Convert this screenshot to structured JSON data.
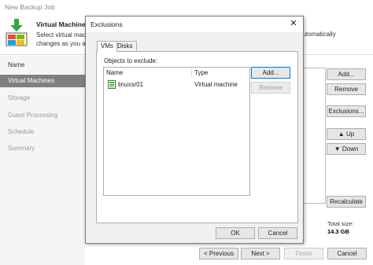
{
  "window": {
    "title": "New Backup Job"
  },
  "header": {
    "title": "Virtual Machines",
    "desc": "Select virtual machines to process via container, or granular changes as you add new VMs to container.",
    "desc_line1": "Select virtual mach",
    "desc_line2": "changes as you ad",
    "desc_right": "automatically"
  },
  "sidebar": {
    "items": [
      {
        "label": "Name"
      },
      {
        "label": "Virtual Machines"
      },
      {
        "label": "Storage"
      },
      {
        "label": "Guest Processing"
      },
      {
        "label": "Schedule"
      },
      {
        "label": "Summary"
      }
    ]
  },
  "right_buttons": {
    "add": "Add...",
    "remove": "Remove",
    "exclusions": "Exclusions...",
    "up": "Up",
    "down": "Down",
    "recalculate": "Recalculate"
  },
  "total": {
    "label": "Total size:",
    "value": "14.3 GB"
  },
  "footer": {
    "previous": "< Previous",
    "next": "Next >",
    "finish": "Finish",
    "cancel": "Cancel"
  },
  "dialog": {
    "title": "Exclusions",
    "tabs": [
      {
        "label": "VMs"
      },
      {
        "label": "Disks"
      }
    ],
    "objects_label": "Objects to exclude:",
    "columns": {
      "name": "Name",
      "type": "Type"
    },
    "rows": [
      {
        "name": "linuxsr01",
        "type": "Virtual machine"
      }
    ],
    "add": "Add...",
    "remove": "Remove",
    "ok": "OK",
    "cancel": "Cancel"
  }
}
